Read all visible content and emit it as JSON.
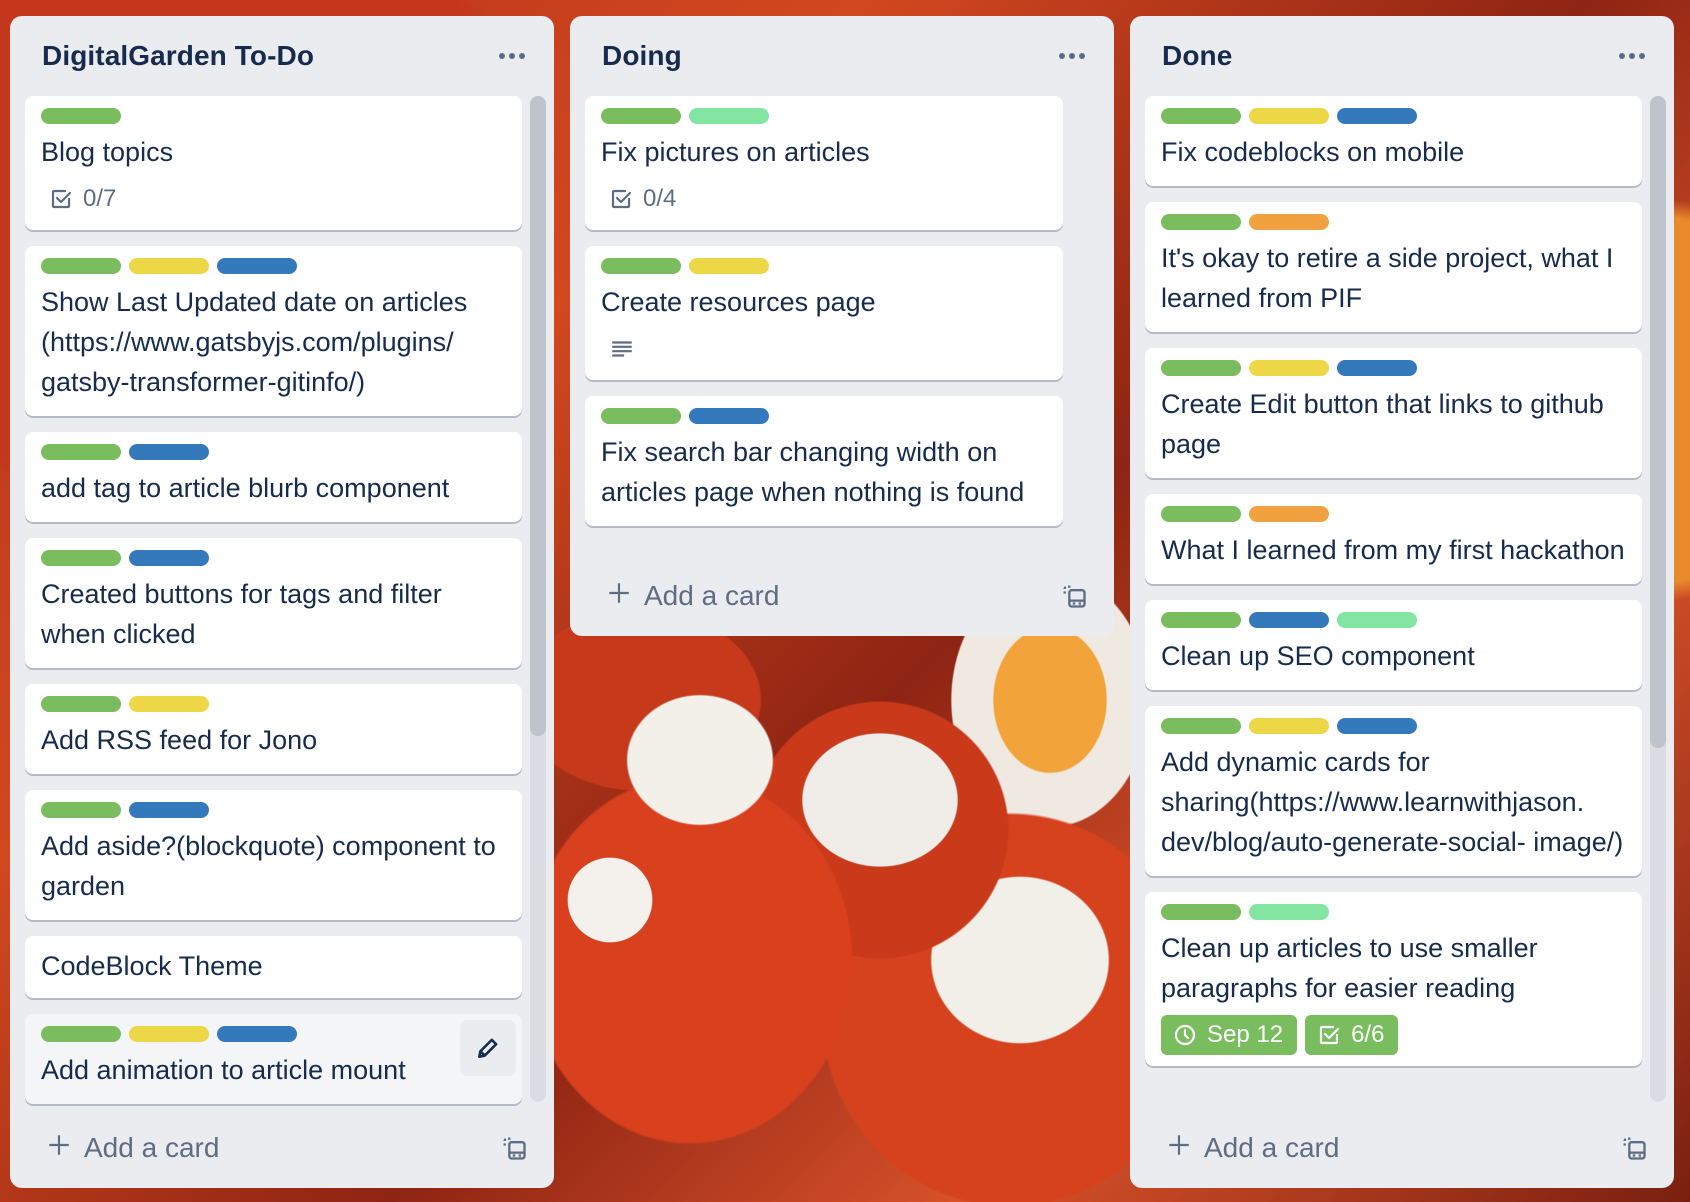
{
  "colors": {
    "green": "#7abd5f",
    "yellow": "#eed747",
    "blue": "#3579bd",
    "lime": "#82e5a1",
    "orange": "#f1a13f",
    "list_bg": "#ebecf0",
    "text": "#172b4d",
    "subtle": "#5e6c84"
  },
  "lists": [
    {
      "title": "DigitalGarden To-Do",
      "add_card_label": "Add a card",
      "cards": [
        {
          "labels": [
            "green"
          ],
          "title": "Blog topics",
          "checklist": "0/7"
        },
        {
          "labels": [
            "green",
            "yellow",
            "blue"
          ],
          "title": "Show Last Updated date on articles (https://www.gatsbyjs.com/plugins/ gatsby-transformer-gitinfo/)"
        },
        {
          "labels": [
            "green",
            "blue"
          ],
          "title": "add tag to article blurb component"
        },
        {
          "labels": [
            "green",
            "blue"
          ],
          "title": "Created buttons for tags and filter when clicked"
        },
        {
          "labels": [
            "green",
            "yellow"
          ],
          "title": "Add RSS feed for Jono"
        },
        {
          "labels": [
            "green",
            "blue"
          ],
          "title": "Add aside?(blockquote) component to garden"
        },
        {
          "labels": [],
          "title": "CodeBlock Theme"
        },
        {
          "labels": [
            "green",
            "yellow",
            "blue"
          ],
          "title": "Add animation to article mount",
          "hovered": true
        }
      ]
    },
    {
      "title": "Doing",
      "add_card_label": "Add a card",
      "cards": [
        {
          "labels": [
            "green",
            "lime"
          ],
          "title": "Fix pictures on articles",
          "checklist": "0/4"
        },
        {
          "labels": [
            "green",
            "yellow"
          ],
          "title": "Create resources page",
          "has_description": true
        },
        {
          "labels": [
            "green",
            "blue"
          ],
          "title": "Fix search bar changing width on articles page when nothing is found"
        }
      ]
    },
    {
      "title": "Done",
      "add_card_label": "Add a card",
      "cards": [
        {
          "labels": [
            "green",
            "yellow",
            "blue"
          ],
          "title": "Fix codeblocks on mobile"
        },
        {
          "labels": [
            "green",
            "orange"
          ],
          "title": "It's okay to retire a side project, what I learned from PIF"
        },
        {
          "labels": [
            "green",
            "yellow",
            "blue"
          ],
          "title": "Create Edit button that links to github page"
        },
        {
          "labels": [
            "green",
            "orange"
          ],
          "title": "What I learned from my first hackathon"
        },
        {
          "labels": [
            "green",
            "blue",
            "lime"
          ],
          "title": "Clean up SEO component"
        },
        {
          "labels": [
            "green",
            "yellow",
            "blue"
          ],
          "title": "Add dynamic cards for sharing(https://www.learnwithjason. dev/blog/auto-generate-social- image/)"
        },
        {
          "labels": [
            "green",
            "lime"
          ],
          "title": "Clean up articles to use smaller paragraphs for easier reading",
          "due": "Sep 12",
          "checklist_complete": "6/6"
        }
      ]
    }
  ],
  "icons": {
    "more": "more-icon",
    "checklist": "checklist-icon",
    "description": "description-icon",
    "clock": "clock-icon",
    "plus": "plus-icon",
    "template": "card-template-icon",
    "edit": "pencil-icon"
  }
}
